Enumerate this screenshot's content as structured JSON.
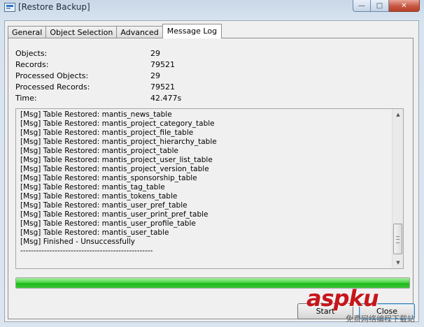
{
  "window": {
    "title": "[Restore Backup]"
  },
  "caption_buttons": {
    "minimize": "—",
    "maximize": "□",
    "close": "✕"
  },
  "tabs": [
    {
      "label": "General",
      "active": false
    },
    {
      "label": "Object Selection",
      "active": false
    },
    {
      "label": "Advanced",
      "active": false
    },
    {
      "label": "Message Log",
      "active": true
    }
  ],
  "stats": [
    {
      "label": "Objects:",
      "value": "29"
    },
    {
      "label": "Records:",
      "value": "79521"
    },
    {
      "label": "Processed Objects:",
      "value": "29"
    },
    {
      "label": "Processed Records:",
      "value": "79521"
    },
    {
      "label": "Time:",
      "value": "42.477s"
    }
  ],
  "log_lines": [
    "[Msg] Table Restored: mantis_news_table",
    "[Msg] Table Restored: mantis_project_category_table",
    "[Msg] Table Restored: mantis_project_file_table",
    "[Msg] Table Restored: mantis_project_hierarchy_table",
    "[Msg] Table Restored: mantis_project_table",
    "[Msg] Table Restored: mantis_project_user_list_table",
    "[Msg] Table Restored: mantis_project_version_table",
    "[Msg] Table Restored: mantis_sponsorship_table",
    "[Msg] Table Restored: mantis_tag_table",
    "[Msg] Table Restored: mantis_tokens_table",
    "[Msg] Table Restored: mantis_user_pref_table",
    "[Msg] Table Restored: mantis_user_print_pref_table",
    "[Msg] Table Restored: mantis_user_profile_table",
    "[Msg] Table Restored: mantis_user_table",
    "[Msg] Finished - Unsuccessfully",
    "--------------------------------------------------"
  ],
  "progress": {
    "percent": 100,
    "color": "#2ec82a"
  },
  "buttons": {
    "start_label": "Start",
    "close_label": "Close"
  },
  "watermark": {
    "main": "asp",
    "accent": "ku",
    "sub": "免费网络编程下载站"
  }
}
